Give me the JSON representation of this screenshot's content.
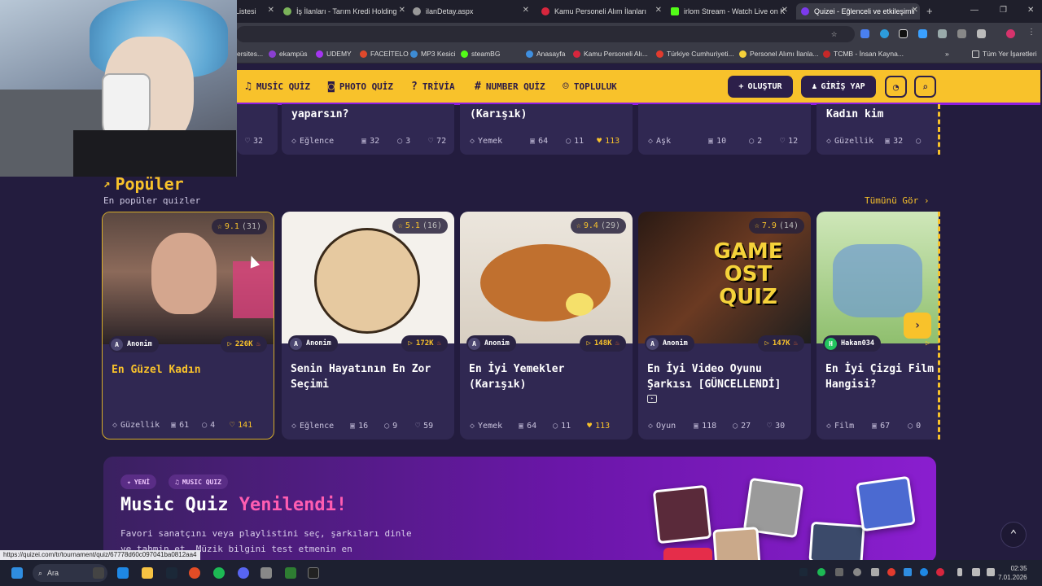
{
  "browser": {
    "tabs": [
      {
        "label": "Listesi"
      },
      {
        "label": "İş İlanları - Tarım Kredi Holding"
      },
      {
        "label": "ilanDetay.aspx"
      },
      {
        "label": "Kamu Personeli Alım İlanları"
      },
      {
        "label": "irlom Stream - Watch Live on K"
      },
      {
        "label": "Quizei - Eğlenceli ve etkileşimli"
      }
    ],
    "new_tab": "+",
    "bookmarks": [
      {
        "label": "ersites..."
      },
      {
        "label": "ekampüs"
      },
      {
        "label": "UDEMY"
      },
      {
        "label": "FACEİTELO"
      },
      {
        "label": "MP3 Kesici"
      },
      {
        "label": "steamBG"
      },
      {
        "label": "Anasayfa"
      },
      {
        "label": "Kamu Personeli Alı..."
      },
      {
        "label": "Türkiye Cumhuriyeti..."
      },
      {
        "label": "Personel Alımı İlanla..."
      },
      {
        "label": "TCMB - İnsan Kayna..."
      },
      {
        "label": "Tüm Yer İşaretleri"
      }
    ],
    "bookmarks_more": "»",
    "status_url": "https://quizei.com/tr/tournament/quiz/67778d60c097041ba0812aa4"
  },
  "nav": {
    "items": [
      {
        "label": "MUSİC QUİZ",
        "icon": "music-icon"
      },
      {
        "label": "PHOTO QUİZ",
        "icon": "camera-icon"
      },
      {
        "label": "TRİVİA",
        "icon": "question-icon"
      },
      {
        "label": "NUMBER QUİZ",
        "icon": "hash-icon"
      },
      {
        "label": "TOPLULUK",
        "icon": "users-icon"
      }
    ],
    "create_label": "OLUŞTUR",
    "login_label": "GİRİŞ YAP"
  },
  "top_row": [
    {
      "title": "",
      "category": "",
      "q": "",
      "c": "",
      "likes": "32"
    },
    {
      "title": "yaparsın?",
      "category": "Eğlence",
      "q": "32",
      "c": "3",
      "likes": "72"
    },
    {
      "title": "(Karışık)",
      "category": "Yemek",
      "q": "64",
      "c": "11",
      "likes": "113"
    },
    {
      "title": "",
      "category": "Aşk",
      "q": "10",
      "c": "2",
      "likes": "12"
    },
    {
      "title": "Kadın kim",
      "category": "Güzellik",
      "q": "32",
      "c": "",
      "likes": ""
    }
  ],
  "section": {
    "title": "Popüler",
    "subtitle": "En popüler quizler",
    "see_all": "Tümünü Gör ›"
  },
  "cards": [
    {
      "rating": "9.1",
      "count": "(31)",
      "author": "Anonim",
      "author_initial": "A",
      "plays": "226K",
      "title": "En Güzel Kadın",
      "category": "Güzellik",
      "q": "61",
      "c": "4",
      "likes": "141",
      "img": "#7a5a4e"
    },
    {
      "rating": "5.1",
      "count": "(16)",
      "author": "Anonim",
      "author_initial": "A",
      "plays": "172K",
      "title": "Senin Hayatının En Zor Seçimi",
      "category": "Eğlence",
      "q": "16",
      "c": "9",
      "likes": "59",
      "img": "#f4f1ec"
    },
    {
      "rating": "9.4",
      "count": "(29)",
      "author": "Anonim",
      "author_initial": "A",
      "plays": "148K",
      "title": "En İyi Yemekler (Karışık)",
      "category": "Yemek",
      "q": "64",
      "c": "11",
      "likes": "113",
      "img": "#e9dfd2"
    },
    {
      "rating": "7.9",
      "count": "(14)",
      "author": "Anonim",
      "author_initial": "A",
      "plays": "147K",
      "title": "En İyi Video Oyunu Şarkısı [GÜNCELLENDİ]",
      "category": "Oyun",
      "q": "118",
      "c": "27",
      "likes": "30",
      "img": "#3a2a22"
    },
    {
      "rating": "",
      "count": "",
      "author": "Hakan034",
      "author_initial": "H",
      "plays": "",
      "title": "En İyi Çizgi Film Hangisi?",
      "category": "Film",
      "q": "67",
      "c": "0",
      "likes": "",
      "img": "#a9c98a"
    }
  ],
  "banner": {
    "badge_new": "YENİ",
    "badge_music": "MUSIC QUIZ",
    "title_main": "Music Quiz",
    "title_accent": "Yenilendi!",
    "desc": "Favori sanatçını veya playlistini seç, şarkıları dinle ve tahmin et. Müzik bilgini test etmenin en"
  },
  "taskbar": {
    "search": "Ara",
    "time": "02:35",
    "date": "7.01.2026"
  },
  "colors": {
    "accent": "#f8c22b",
    "bg": "#231c3e",
    "card": "#302852",
    "pink": "#ff5db1",
    "purple": "#8e1de0"
  }
}
